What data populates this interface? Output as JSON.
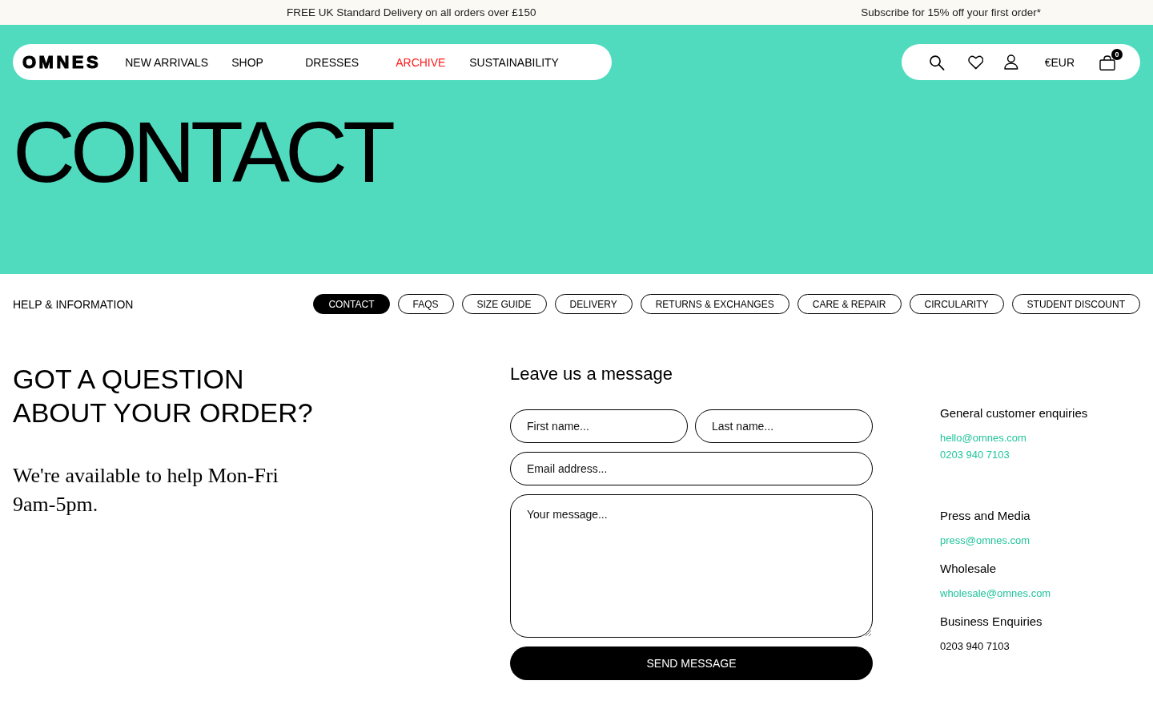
{
  "announcement_bar": {
    "items": [
      "FREE UK Standard Delivery on all orders over £150",
      "Subscribe for 15% off your first order*"
    ]
  },
  "header": {
    "logo": "OMNES",
    "nav": [
      {
        "label": "NEW ARRIVALS",
        "highlighted": false
      },
      {
        "label": "SHOP",
        "highlighted": false
      },
      {
        "label": "DRESSES",
        "highlighted": false
      },
      {
        "label": "ARCHIVE",
        "highlighted": true
      },
      {
        "label": "SUSTAINABILITY",
        "highlighted": false
      }
    ],
    "currency": "€EUR",
    "cart_count": "0"
  },
  "hero": {
    "title": "CONTACT"
  },
  "help_nav": {
    "title": "HELP & INFORMATION",
    "tabs": [
      {
        "label": "CONTACT",
        "selected": true
      },
      {
        "label": "FAQS",
        "selected": false
      },
      {
        "label": "SIZE GUIDE",
        "selected": false
      },
      {
        "label": "DELIVERY",
        "selected": false
      },
      {
        "label": "RETURNS & EXCHANGES",
        "selected": false
      },
      {
        "label": "CARE & REPAIR",
        "selected": false
      },
      {
        "label": "CIRCULARITY",
        "selected": false
      },
      {
        "label": "STUDENT DISCOUNT",
        "selected": false
      }
    ]
  },
  "intro": {
    "heading": "GOT A QUESTION ABOUT YOUR ORDER?",
    "text": "We're available to help Mon-Fri 9am-5pm."
  },
  "form": {
    "title": "Leave us a message",
    "name_fields": [
      {
        "placeholder": "First name..."
      },
      {
        "placeholder": "Last name..."
      }
    ],
    "email_field": {
      "placeholder": "Email address..."
    },
    "message_field": {
      "placeholder": "Your message..."
    },
    "submit_button": "SEND MESSAGE"
  },
  "contacts": [
    {
      "heading": "General customer enquiries",
      "lines": [
        {
          "text": "hello@omnes.com",
          "kind": "link"
        },
        {
          "text": "0203 940 7103",
          "kind": "link"
        }
      ]
    },
    {
      "heading": "Press and Media",
      "lines": [
        {
          "text": "press@omnes.com",
          "kind": "link"
        }
      ]
    },
    {
      "heading": "Wholesale",
      "lines": [
        {
          "text": "wholesale@omnes.com",
          "kind": "link"
        }
      ]
    },
    {
      "heading": "Business Enquiries",
      "lines": [
        {
          "text": "0203 940 7103",
          "kind": "plain"
        }
      ]
    }
  ]
}
